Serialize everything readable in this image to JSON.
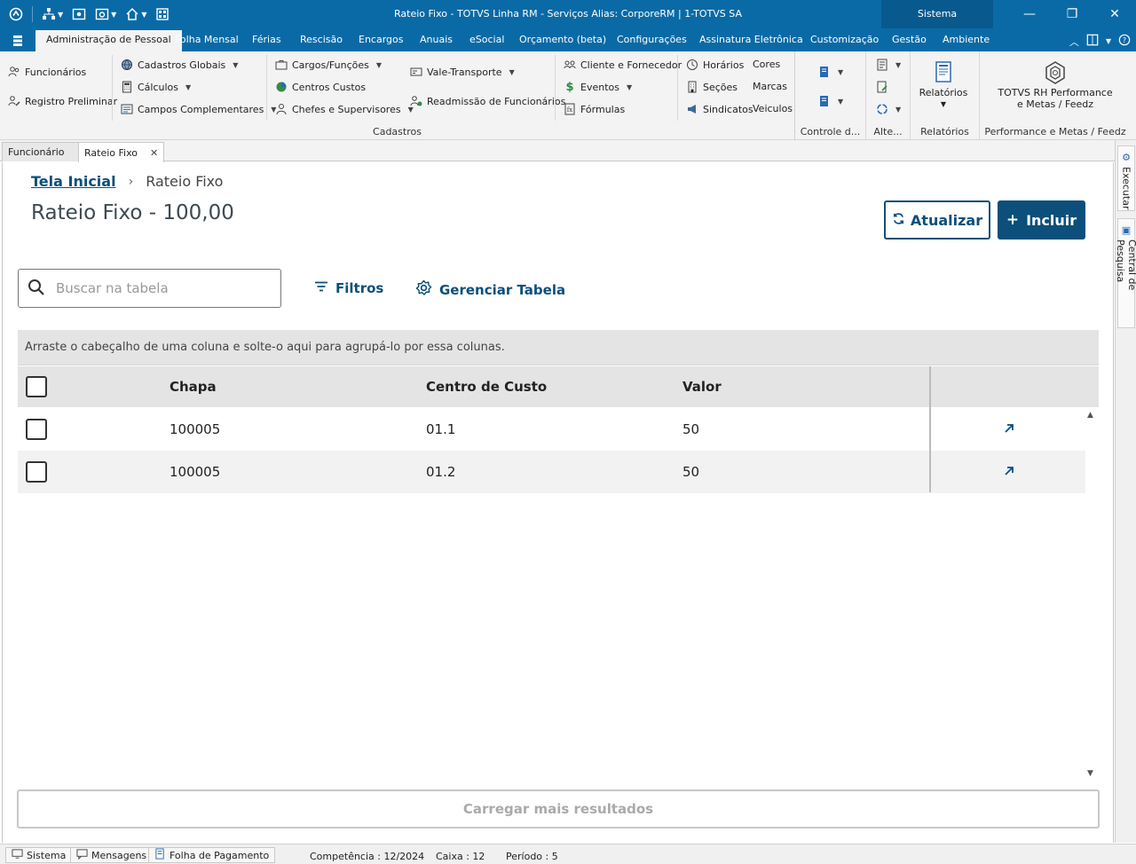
{
  "window": {
    "title": "Rateio Fixo - TOTVS Linha RM - Serviços  Alias: CorporeRM | 1-TOTVS SA",
    "sistema_label": "Sistema"
  },
  "ribbon_tabs": [
    {
      "label": "Administração de Pessoal",
      "active": true
    },
    {
      "label": "Folha Mensal"
    },
    {
      "label": "Férias"
    },
    {
      "label": "Rescisão"
    },
    {
      "label": "Encargos"
    },
    {
      "label": "Anuais"
    },
    {
      "label": "eSocial"
    },
    {
      "label": "Orçamento (beta)"
    },
    {
      "label": "Configurações"
    },
    {
      "label": "Assinatura Eletrônica"
    },
    {
      "label": "Customização"
    },
    {
      "label": "Gestão"
    },
    {
      "label": "Ambiente"
    }
  ],
  "ribbon": {
    "col1": [
      "Funcionários",
      "Registro Preliminar"
    ],
    "col2": [
      "Cadastros Globais",
      "Cálculos",
      "Campos Complementares"
    ],
    "col3": [
      "Cargos/Funções",
      "Centros Custos",
      "Chefes e Supervisores"
    ],
    "col4": [
      "Vale-Transporte",
      "Readmissão de Funcionários"
    ],
    "col5": [
      "Cliente e Fornecedor",
      "Eventos",
      "Fórmulas"
    ],
    "col6": [
      "Horários",
      "Seções",
      "Sindicatos"
    ],
    "col7": [
      "Cores",
      "Marcas",
      "Veiculos"
    ],
    "group_cadastros": "Cadastros",
    "group_controle": "Controle d...",
    "group_alte": "Alte...",
    "relatorios_button": "Relatórios",
    "group_relatorios": "Relatórios",
    "performance_button_line1": "TOTVS RH Performance",
    "performance_button_line2": "e Metas / Feedz",
    "group_performance": "Performance e Metas / Feedz"
  },
  "doc_tabs": [
    {
      "label": "Funcionário"
    },
    {
      "label": "Rateio Fixo",
      "active": true
    }
  ],
  "side_tabs": [
    "Executar",
    "Central de Pesquisa"
  ],
  "page": {
    "breadcrumb_home": "Tela Inicial",
    "breadcrumb_current": "Rateio Fixo",
    "title": "Rateio Fixo - 100,00",
    "refresh_label": "Atualizar",
    "add_label": "Incluir",
    "search_placeholder": "Buscar na tabela",
    "filters_label": "Filtros",
    "manage_table_label": "Gerenciar Tabela",
    "group_hint": "Arraste o cabeçalho de uma coluna e solte-o aqui para agrupá-lo por essa colunas.",
    "columns": [
      "Chapa",
      "Centro de Custo",
      "Valor"
    ],
    "rows": [
      {
        "chapa": "100005",
        "centro": "01.1",
        "valor": "50"
      },
      {
        "chapa": "100005",
        "centro": "01.2",
        "valor": "50"
      }
    ],
    "load_more_label": "Carregar mais resultados"
  },
  "status": {
    "sistema": "Sistema",
    "mensagens": "Mensagens",
    "folha": "Folha de Pagamento",
    "competencia": "Competência : 12/2024",
    "caixa": "Caixa : 12",
    "periodo": "Período : 5"
  },
  "colors": {
    "titlebar": "#0a6aa6",
    "primary": "#0b4f7a",
    "ribbon_bg": "#f3f3f3"
  }
}
